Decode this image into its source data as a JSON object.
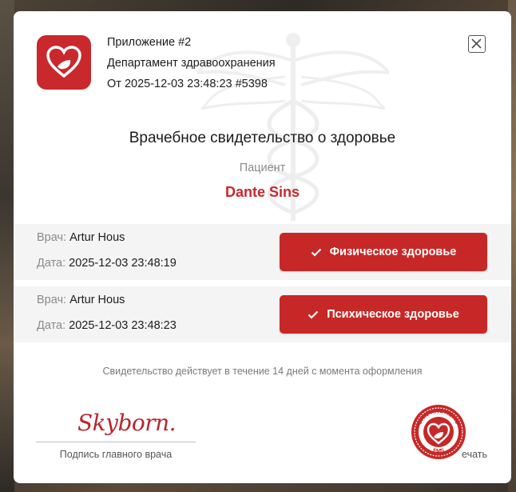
{
  "header": {
    "app_line": "Приложение #2",
    "department": "Департамент здравоохранения",
    "issued": "От 2025-12-03 23:48:23 #5398"
  },
  "document": {
    "title": "Врачебное свидетельство о здоровье",
    "patient_label": "Пациент",
    "patient_name": "Dante Sins"
  },
  "records": [
    {
      "doctor_label": "Врач:",
      "doctor": "Artur Hous",
      "date_label": "Дата:",
      "date": "2025-12-03 23:48:19",
      "button": "Физическое здоровье"
    },
    {
      "doctor_label": "Врач:",
      "doctor": "Artur Hous",
      "date_label": "Дата:",
      "date": "2025-12-03 23:48:23",
      "button": "Психическое здоровье"
    }
  ],
  "validity_note": "Свидетельство действует в течение 14 дней с момента оформления",
  "signature": {
    "text": "Skyborn.",
    "caption": "Подпись главного врача"
  },
  "stamp": {
    "caption": "ечать",
    "ring_top": "SAN ANDREAS",
    "ring_bottom": "EMS"
  },
  "colors": {
    "accent": "#c62828",
    "app_icon": "#c9282d"
  },
  "icons": {
    "app": "heart-icon",
    "close": "close-icon",
    "check": "check-icon",
    "watermark": "caduceus-icon"
  }
}
